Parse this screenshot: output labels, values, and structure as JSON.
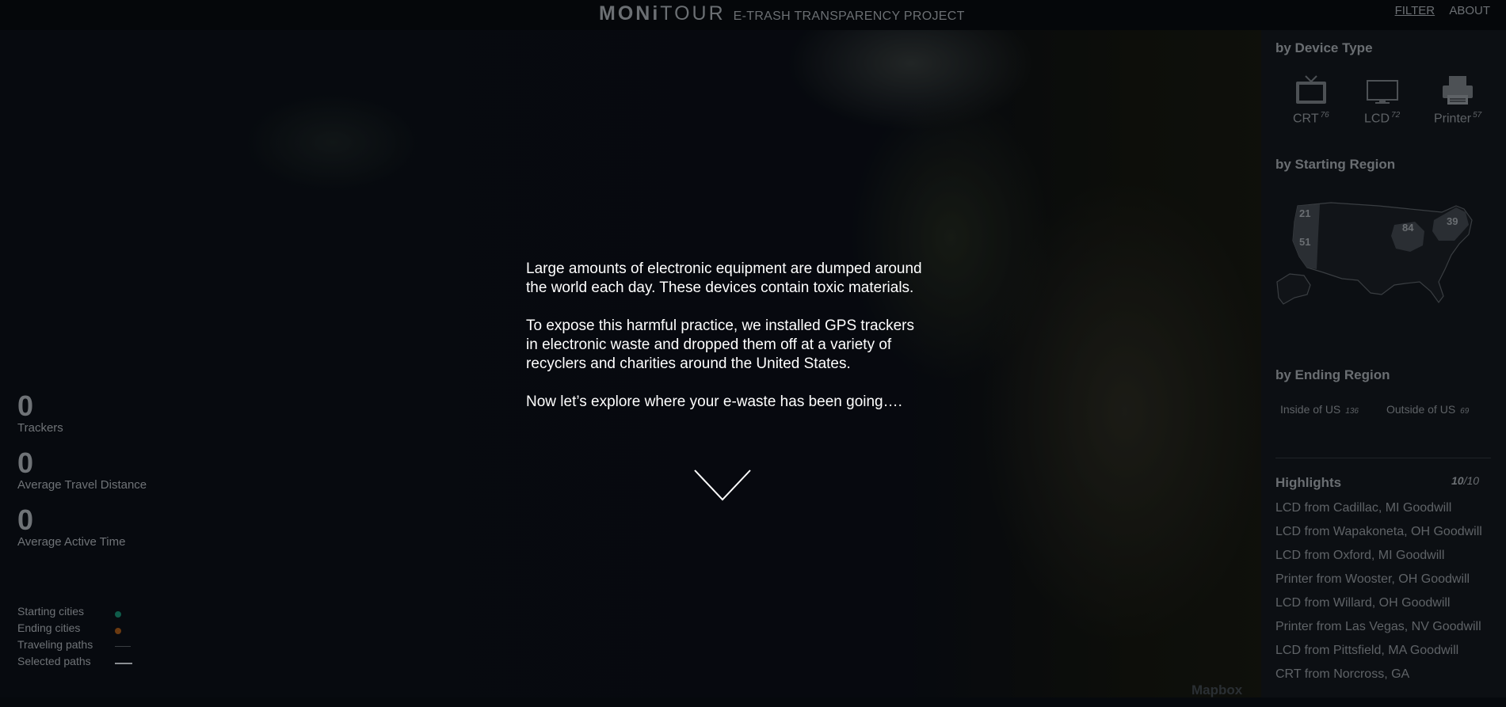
{
  "header": {
    "brand_bold": "MONi",
    "brand_light": "TOUR",
    "subtitle": "E-TRASH TRANSPARENCY PROJECT",
    "nav_filter": "FILTER",
    "nav_about": "ABOUT"
  },
  "intro": {
    "p1": "Large amounts of electronic equipment are dumped around the world each day. These devices contain toxic materials.",
    "p2": "To expose this harmful practice, we installed GPS trackers in electronic waste and dropped them off at a variety of recyclers and charities around the United States.",
    "p3": "Now let’s explore where your e-waste has been going…."
  },
  "stats": {
    "trackers_value": "0",
    "trackers_label": "Trackers",
    "distance_value": "0",
    "distance_label": "Average Travel Distance",
    "time_value": "0",
    "time_label": "Average Active Time"
  },
  "legend": {
    "starting": "Starting cities",
    "ending": "Ending cities",
    "traveling": "Traveling paths",
    "selected": "Selected paths",
    "starting_color": "#0f5c4a",
    "ending_color": "#6b3a10"
  },
  "panel": {
    "device_title": "by Device Type",
    "devices": [
      {
        "label": "CRT",
        "count": "76",
        "icon": "tv-icon"
      },
      {
        "label": "LCD",
        "count": "72",
        "icon": "monitor-icon"
      },
      {
        "label": "Printer",
        "count": "57",
        "icon": "printer-icon"
      }
    ],
    "start_title": "by Starting Region",
    "regions": [
      {
        "value": "21"
      },
      {
        "value": "51"
      },
      {
        "value": "84"
      },
      {
        "value": "39"
      }
    ],
    "end_title": "by Ending Region",
    "ending": [
      {
        "label": "Inside of US",
        "count": "136"
      },
      {
        "label": "Outside of US",
        "count": "69"
      }
    ],
    "highlights_title": "Highlights",
    "highlights_shown": "10",
    "highlights_total": "/10",
    "highlights": [
      "LCD from Cadillac, MI Goodwill",
      "LCD from Wapakoneta, OH Goodwill",
      "LCD from Oxford, MI Goodwill",
      "Printer from Wooster, OH Goodwill",
      "LCD from Willard, OH Goodwill",
      "Printer from Las Vegas, NV Goodwill",
      "LCD from Pittsfield, MA Goodwill",
      "CRT from Norcross, GA"
    ]
  },
  "map": {
    "attribution": "Mapbox"
  }
}
